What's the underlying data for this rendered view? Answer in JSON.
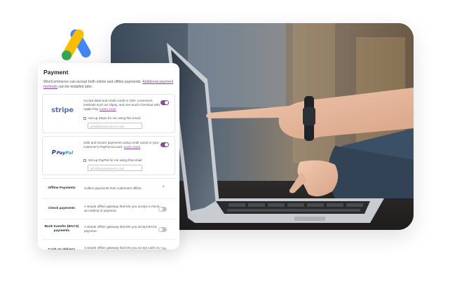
{
  "payment_card": {
    "title": "Payment",
    "desc_text": "WooCommerce can accept both online and offline payments. ",
    "desc_link": "Additional payment methods",
    "desc_suffix": " can be installed later.",
    "providers": [
      {
        "brand": "stripe",
        "description": "Accept debit and credit cards in 135+ currencies, methods such as Alipay, and one-touch checkout with Apple Pay. ",
        "learn_more": "Learn more",
        "setup_label": "Set up Stripe for me using this email:",
        "email_placeholder": "john@woocommerce.com",
        "enabled": true
      },
      {
        "brand_pay": "Pay",
        "brand_pal": "Pal",
        "brand_p": "P",
        "description": "Safe and secure payments using credit cards or your customer's PayPal account. ",
        "learn_more": "Learn more",
        "setup_label": "Set up PayPal for me using this email:",
        "email_placeholder": "john@woocommerce.com",
        "enabled": true
      }
    ],
    "offline": [
      {
        "name": "Offline Payments",
        "description": "Collect payments from customers offline.",
        "control": "chevron-up"
      },
      {
        "name": "Check payments",
        "description": "A simple offline gateway that lets you accept a check as method of payment.",
        "enabled": false
      },
      {
        "name": "Bank transfer (BACS) payments",
        "description": "A simple offline gateway that lets you accept BACS payment.",
        "enabled": false
      },
      {
        "name": "Cash on delivery",
        "description": "A simple offline gateway that lets you accept cash on delivery.",
        "enabled": false
      }
    ]
  },
  "icons": {
    "logo": "google-ads-logo-icon",
    "chevron": "chevron-up-icon"
  },
  "colors": {
    "accent": "#8c4a9d",
    "toggle_off": "#c3c4c7",
    "ads_blue": "#4285f4",
    "ads_yellow": "#fbbc04",
    "ads_green": "#34a853"
  },
  "photo": {
    "subject": "laptop-with-pointing-hands-photo"
  }
}
